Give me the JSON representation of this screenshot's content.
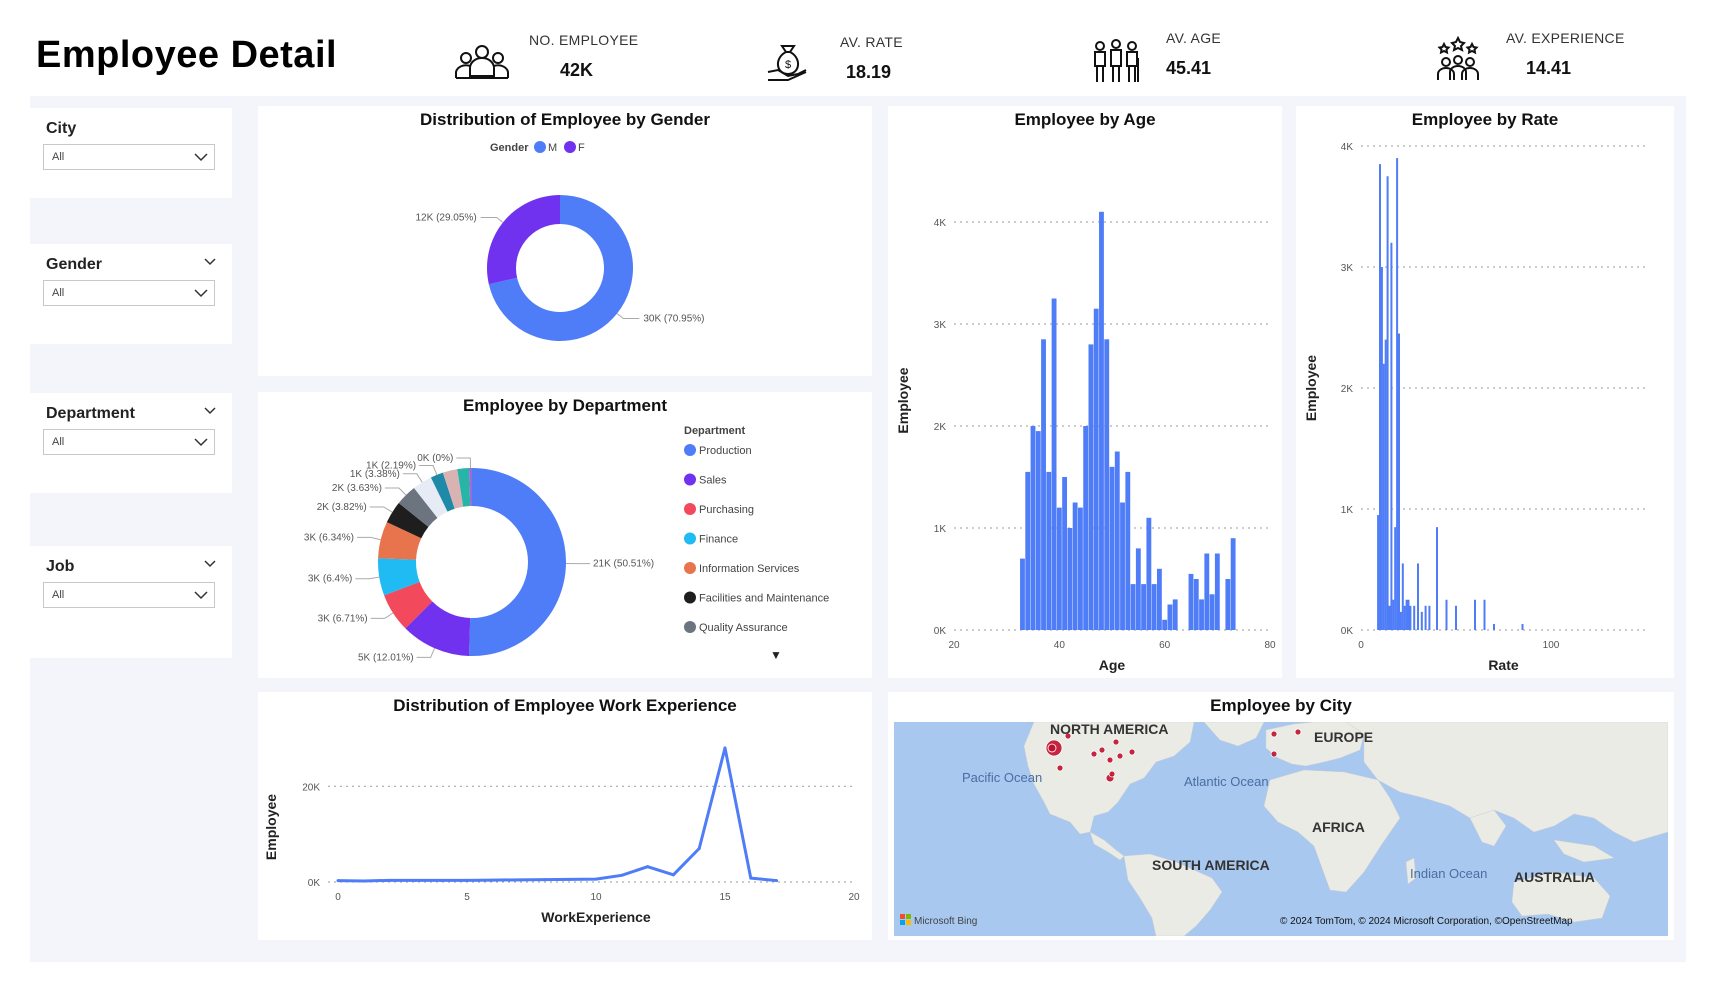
{
  "header": {
    "title": "Employee Detail"
  },
  "kpis": [
    {
      "label": "NO. EMPLOYEE",
      "value": "42K",
      "icon": "people-group-icon"
    },
    {
      "label": "AV. RATE",
      "value": "18.19",
      "icon": "money-bag-hand-icon"
    },
    {
      "label": "AV. AGE",
      "value": "45.41",
      "icon": "age-people-icon"
    },
    {
      "label": "AV. EXPERIENCE",
      "value": "14.41",
      "icon": "star-team-icon"
    }
  ],
  "slicers": [
    {
      "title": "City",
      "value": "All"
    },
    {
      "title": "Gender",
      "value": "All"
    },
    {
      "title": "Department",
      "value": "All"
    },
    {
      "title": "Job",
      "value": "All"
    }
  ],
  "colors": {
    "blue": "#4f7cf7",
    "purple": "#7132f0",
    "red": "#f2495d",
    "cyan": "#1fbbf2",
    "orange": "#e8744d",
    "black": "#1e1e1e",
    "gray": "#6c7480",
    "teal": "#1e8aa8",
    "map_water": "#a8c8f0",
    "map_land": "#ebebe6",
    "city_dot": "#c0102c"
  },
  "chart_data": [
    {
      "id": "gender",
      "type": "pie",
      "title": "Distribution of Employee by Gender",
      "legend_title": "Gender",
      "legend_position": "top",
      "slices": [
        {
          "name": "M",
          "value": 30,
          "label": "30K (70.95%)",
          "color": "#4f7cf7"
        },
        {
          "name": "F",
          "value": 12,
          "label": "12K (29.05%)",
          "color": "#7132f0"
        }
      ]
    },
    {
      "id": "department",
      "type": "pie",
      "title": "Employee by Department",
      "legend_title": "Department",
      "legend_position": "right",
      "slices": [
        {
          "name": "Production",
          "value": 50.51,
          "label": "21K (50.51%)",
          "color": "#4f7cf7"
        },
        {
          "name": "Sales",
          "value": 12.01,
          "label": "5K (12.01%)",
          "color": "#7132f0"
        },
        {
          "name": "Purchasing",
          "value": 6.71,
          "label": "3K (6.71%)",
          "color": "#f2495d"
        },
        {
          "name": "Finance",
          "value": 6.4,
          "label": "3K (6.4%)",
          "color": "#1fbbf2"
        },
        {
          "name": "Information Services",
          "value": 6.34,
          "label": "3K (6.34%)",
          "color": "#e8744d"
        },
        {
          "name": "Facilities and Maintenance",
          "value": 3.82,
          "label": "2K (3.82%)",
          "color": "#1e1e1e"
        },
        {
          "name": "Quality Assurance",
          "value": 3.63,
          "label": "2K (3.63%)",
          "color": "#6c7480"
        },
        {
          "name": "",
          "value": 3.38,
          "label": "1K (3.38%)",
          "color": "#e6ebf5"
        },
        {
          "name": "",
          "value": 2.19,
          "label": "1K (2.19%)",
          "color": "#1e8aa8"
        },
        {
          "name": "",
          "value": 2.5,
          "label": "",
          "color": "#d9b3b3"
        },
        {
          "name": "",
          "value": 2.0,
          "label": "",
          "color": "#26b5a6"
        },
        {
          "name": "",
          "value": 0.51,
          "label": "0K (0%)",
          "color": "#9b6cd6"
        }
      ]
    },
    {
      "id": "age",
      "type": "bar",
      "title": "Employee by Age",
      "xlabel": "Age",
      "ylabel": "Employee",
      "xlim": [
        20,
        80
      ],
      "ylim": [
        0,
        4500
      ],
      "xticks": [
        "20",
        "40",
        "60",
        "80"
      ],
      "yticks": [
        "0K",
        "1K",
        "2K",
        "3K",
        "4K"
      ],
      "grid": true,
      "x": [
        33,
        34,
        35,
        36,
        37,
        38,
        39,
        40,
        41,
        42,
        43,
        44,
        45,
        46,
        47,
        48,
        49,
        50,
        51,
        52,
        53,
        54,
        55,
        56,
        57,
        58,
        59,
        60,
        61,
        62,
        63,
        64,
        65,
        66,
        67,
        68,
        69,
        70,
        71,
        72,
        73
      ],
      "values": [
        700,
        1550,
        2000,
        1950,
        2850,
        1550,
        3250,
        1200,
        1500,
        1000,
        1250,
        1200,
        2000,
        2800,
        3150,
        4100,
        2850,
        1600,
        1750,
        1250,
        1550,
        450,
        800,
        450,
        1100,
        450,
        600,
        100,
        250,
        300,
        0,
        0,
        550,
        500,
        300,
        750,
        350,
        750,
        0,
        500,
        900
      ]
    },
    {
      "id": "rate",
      "type": "bar",
      "title": "Employee by Rate",
      "xlabel": "Rate",
      "ylabel": "Employee",
      "xlim": [
        0,
        150
      ],
      "ylim": [
        0,
        4000
      ],
      "xticks": [
        "0",
        "100"
      ],
      "yticks": [
        "0K",
        "1K",
        "2K",
        "3K",
        "4K"
      ],
      "grid": true,
      "x": [
        9,
        10,
        11,
        12,
        13,
        14,
        15,
        16,
        17,
        18,
        19,
        20,
        21,
        22,
        23,
        24,
        25,
        26,
        28,
        30,
        32,
        34,
        36,
        40,
        45,
        50,
        60,
        65,
        70,
        85
      ],
      "values": [
        950,
        3850,
        3000,
        2200,
        2400,
        3750,
        200,
        3200,
        250,
        850,
        3900,
        2450,
        150,
        550,
        200,
        250,
        250,
        200,
        200,
        550,
        150,
        200,
        200,
        850,
        250,
        200,
        250,
        250,
        50,
        50
      ]
    },
    {
      "id": "experience",
      "type": "line",
      "title": "Distribution of Employee Work Experience",
      "xlabel": "WorkExperience",
      "ylabel": "Employee",
      "xlim": [
        0,
        20
      ],
      "ylim": [
        0,
        28000
      ],
      "xticks": [
        "0",
        "5",
        "10",
        "15",
        "20"
      ],
      "yticks": [
        "0K",
        "20K"
      ],
      "grid": true,
      "x": [
        0,
        1,
        2,
        3,
        4,
        5,
        6,
        7,
        8,
        9,
        10,
        11,
        12,
        13,
        14,
        15,
        16,
        17
      ],
      "values": [
        300,
        200,
        350,
        350,
        350,
        350,
        400,
        450,
        500,
        550,
        600,
        1400,
        3200,
        1500,
        7000,
        28000,
        800,
        300
      ]
    }
  ],
  "map": {
    "title": "Employee by City",
    "labels": [
      "NORTH AMERICA",
      "EUROPE",
      "AFRICA",
      "SOUTH AMERICA",
      "AUSTRALIA"
    ],
    "ocean_labels": [
      "Pacific Ocean",
      "Atlantic Ocean",
      "Indian Ocean"
    ],
    "attribution": "© 2024 TomTom, © 2024 Microsoft Corporation, ©OpenStreetMap",
    "bing": "Microsoft Bing"
  },
  "more_indicator": "▼"
}
